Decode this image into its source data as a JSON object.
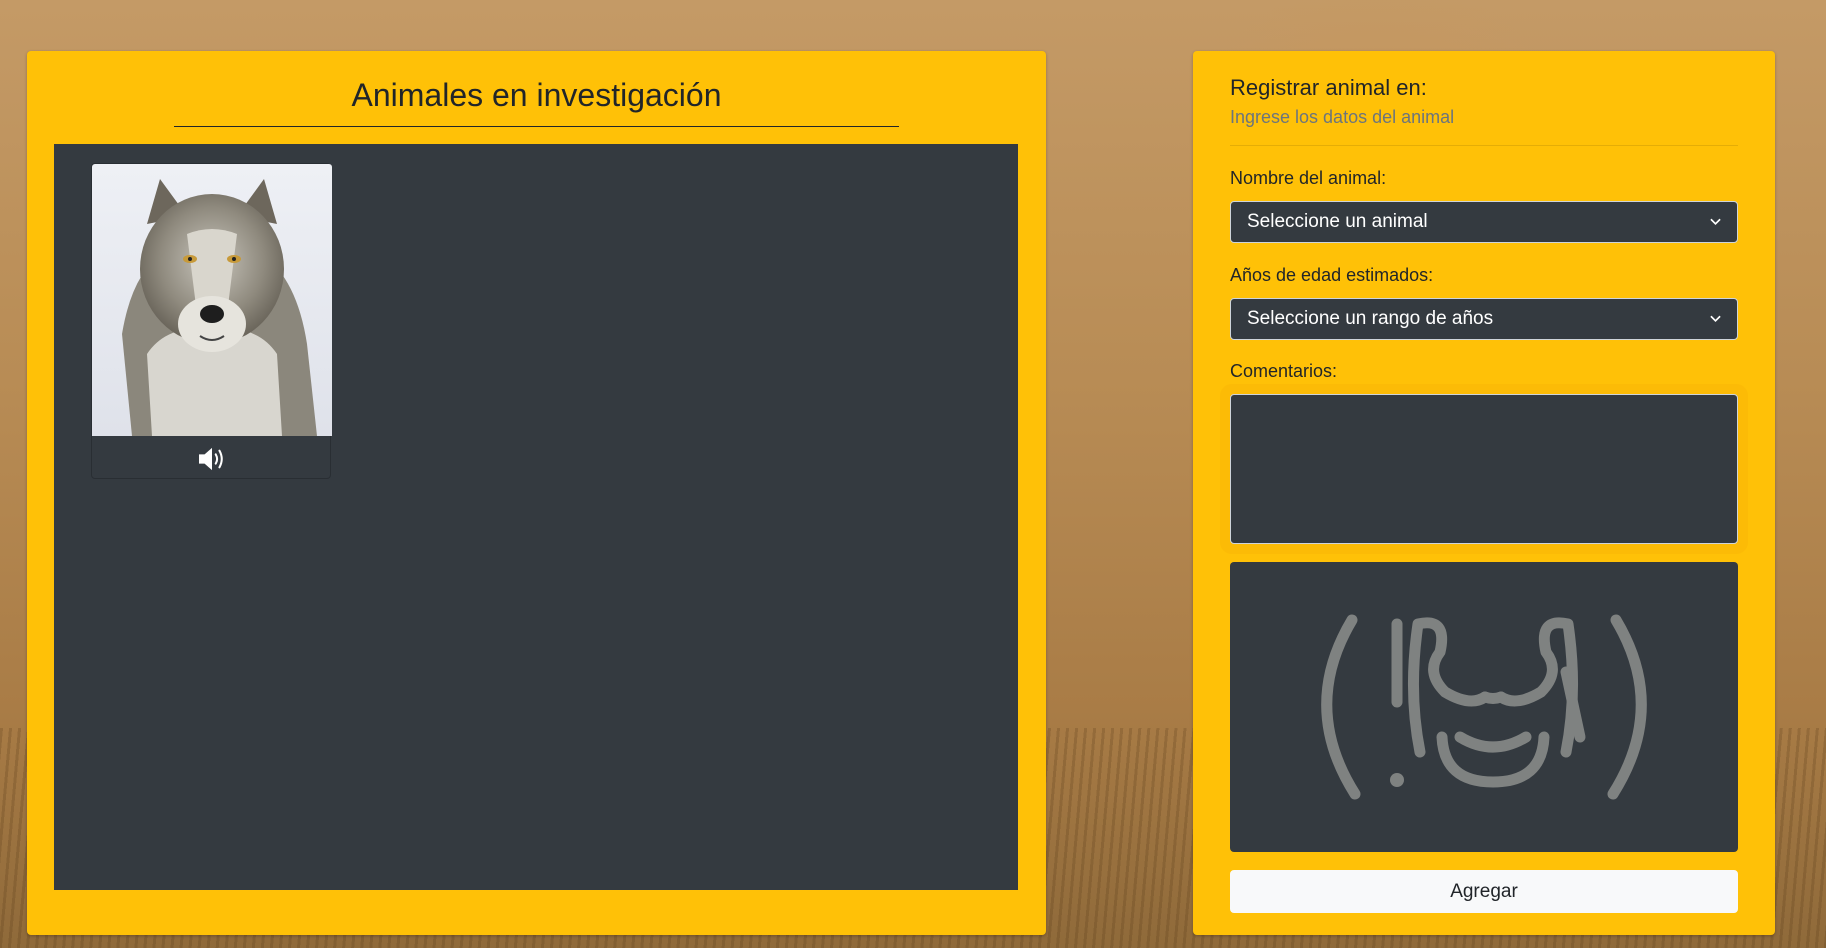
{
  "investigation": {
    "title": "Animales en investigación"
  },
  "form": {
    "heading": "Registrar animal en:",
    "subheading": "Ingrese los datos del animal",
    "name_label": "Nombre del animal:",
    "name_select_value": "Seleccione un animal",
    "age_label": "Años de edad estimados:",
    "age_select_value": "Seleccione un rango de años",
    "comments_label": "Comentarios:",
    "comments_value": "",
    "add_button_label": "Agregar"
  },
  "icons": {
    "sound": "speaker-icon",
    "select_arrow": "chevron-down-icon",
    "preview_placeholder": "animal-alert-icon",
    "animal_photo": "wolf-image"
  },
  "colors": {
    "panel": "#ffc107",
    "dark": "#343a40",
    "button": "#f8f9fa",
    "placeholder_icon": "#7f8281"
  }
}
